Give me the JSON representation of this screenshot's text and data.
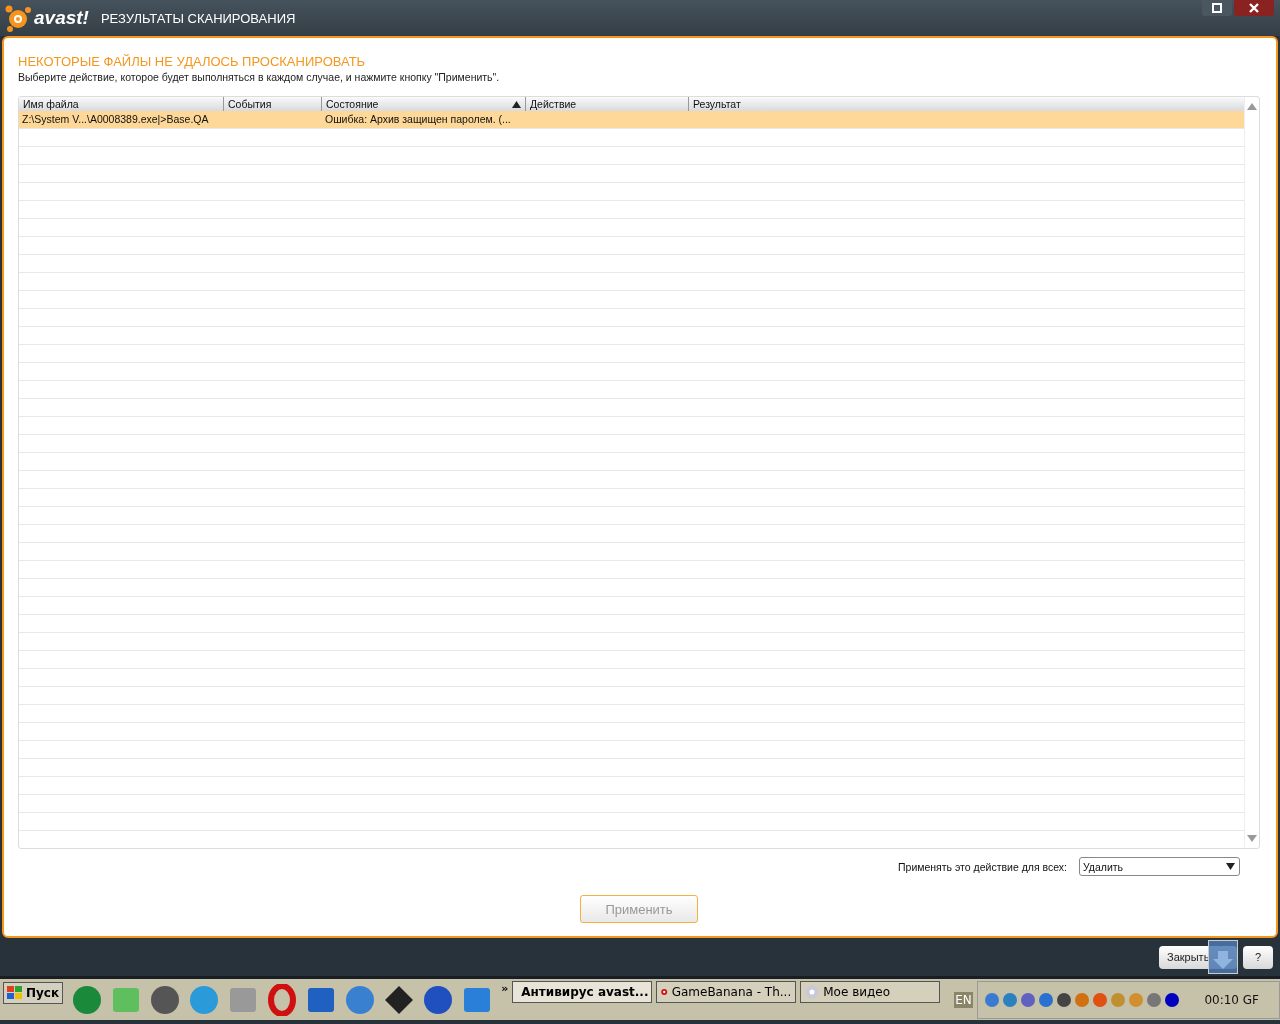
{
  "app": {
    "logo": "avast!",
    "title": "РЕЗУЛЬТАТЫ СКАНИРОВАНИЯ"
  },
  "heading": "НЕКОТОРЫЕ ФАЙЛЫ НЕ УДАЛОСЬ ПРОСКАНИРОВАТЬ",
  "instruction": "Выберите действие, которое будет выполняться в каждом случае, и нажмите кнопку \"Применить\".",
  "table": {
    "columns": [
      {
        "label": "Имя файла",
        "sorted": false
      },
      {
        "label": "События",
        "sorted": false
      },
      {
        "label": "Состояние",
        "sorted": true
      },
      {
        "label": "Действие",
        "sorted": false
      },
      {
        "label": "Результат",
        "sorted": false
      }
    ],
    "rows": [
      {
        "cells": [
          "Z:\\System V...\\A0008389.exe|>Base.QA",
          "",
          "Ошибка: Архив защищен паролем. (...",
          "",
          ""
        ],
        "selected": true
      }
    ]
  },
  "apply_all": {
    "label": "Применять это действие для всех:",
    "value": "Удалить"
  },
  "apply_button": {
    "label": "Применить",
    "disabled": true
  },
  "footer_buttons": [
    "Закрыть",
    "?"
  ],
  "taskbar": {
    "start": "Пуск",
    "chevron": "»",
    "tasks": [
      {
        "label": "Антивирус avast...",
        "selected": true
      },
      {
        "label": "GameBanana - Th...",
        "selected": false
      },
      {
        "label": "Мое видео",
        "selected": false
      }
    ],
    "language": "EN",
    "clock": "00:10 GF"
  }
}
